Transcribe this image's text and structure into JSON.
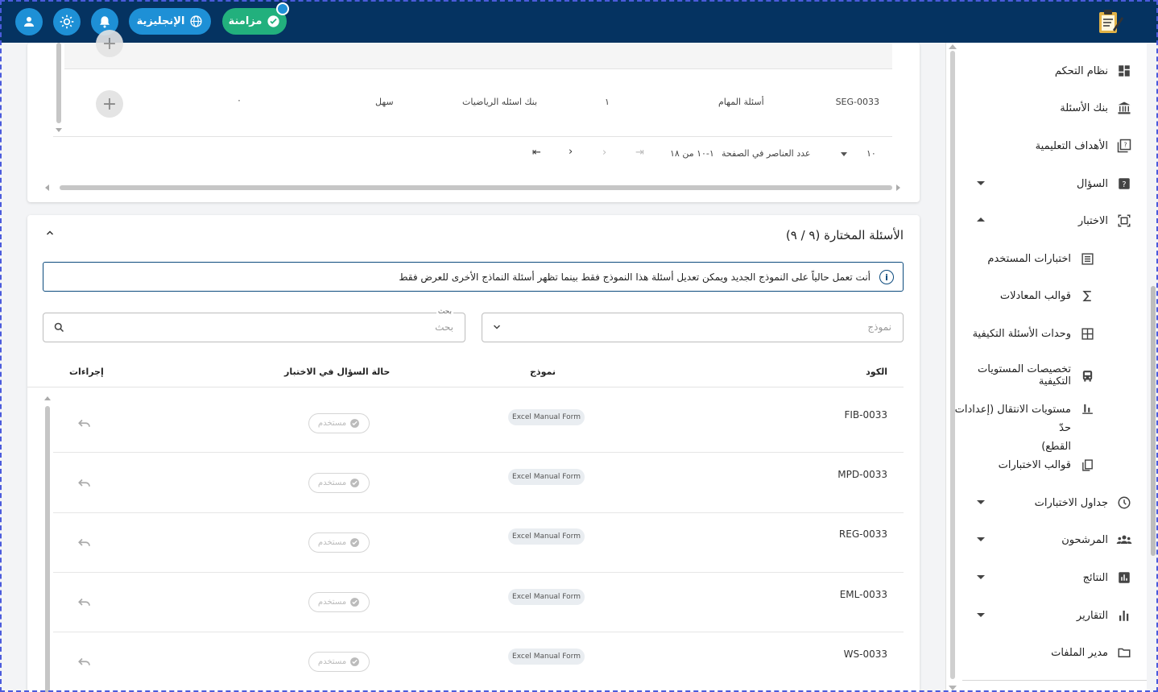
{
  "topbar": {
    "sync_label": "مزامنة",
    "language_label": "الإنجليزية",
    "icons": [
      "user-icon",
      "sun-icon",
      "bell-icon",
      "globe-icon",
      "check-icon"
    ]
  },
  "sidebar": {
    "items": [
      {
        "label": "نظام التحكم",
        "icon": "dashboard-icon"
      },
      {
        "label": "بنك الأسئلة",
        "icon": "bank-icon"
      },
      {
        "label": "الأهداف التعليمية",
        "icon": "objectives-icon"
      },
      {
        "label": "السؤال",
        "icon": "question-icon"
      },
      {
        "label": "الاختبار",
        "icon": "exam-icon"
      },
      {
        "label": "اختبارات المستخدم",
        "icon": "list-icon"
      },
      {
        "label": "قوالب المعادلات",
        "icon": "sigma-icon"
      },
      {
        "label": "وحدات الأسئلة التكيفية",
        "icon": "grid-icon"
      },
      {
        "label": "تخصيصات المستويات التكيفية",
        "icon": "bus-icon"
      },
      {
        "label": "مستويات الانتقال (إعدادات حدّ",
        "label2": "القطع)",
        "icon": "bar-icon"
      },
      {
        "label": "قوالب الاختبارات",
        "icon": "copy-icon"
      },
      {
        "label": "جداول الاختبارات",
        "icon": "clock-icon"
      },
      {
        "label": "المرشحون",
        "icon": "people-icon"
      },
      {
        "label": "النتائج",
        "icon": "results-icon"
      },
      {
        "label": "التقارير",
        "icon": "reports-icon"
      },
      {
        "label": "مدير الملفات",
        "icon": "folder-icon"
      }
    ]
  },
  "top_table": {
    "row": {
      "code": "SEG-0033",
      "type": "أسئلة المهام",
      "count": "١",
      "bank": "بنك اسئله الرياضيات",
      "difficulty": "سهل",
      "extra": "٠"
    },
    "pagination": {
      "per_page_value": "١٠",
      "per_page_label": "عدد العناصر في الصفحة",
      "range": "١-١٠ من ١٨"
    }
  },
  "selected": {
    "title": "الأسئلة المختارة (٩ / ٩)",
    "info": "أنت تعمل حالياً على النموذج الجديد ويمكن تعديل أسئلة هذا النموذج فقط بينما تظهر أسئلة النماذج الأخرى للعرض فقط",
    "model_placeholder": "نموذج",
    "search_legend": "بحث",
    "search_placeholder": "بحث",
    "columns": {
      "code": "الكود",
      "model": "نموذج",
      "status": "حالة السؤال في الاختبار",
      "actions": "إجراءات"
    },
    "rows": [
      {
        "code": "FIB-0033",
        "model": "Excel Manual Form",
        "status": "مستخدم"
      },
      {
        "code": "MPD-0033",
        "model": "Excel Manual Form",
        "status": "مستخدم"
      },
      {
        "code": "REG-0033",
        "model": "Excel Manual Form",
        "status": "مستخدم"
      },
      {
        "code": "EML-0033",
        "model": "Excel Manual Form",
        "status": "مستخدم"
      },
      {
        "code": "WS-0033",
        "model": "Excel Manual Form",
        "status": "مستخدم"
      }
    ]
  },
  "colors": {
    "topbar": "#053361",
    "accent": "#1e90d6",
    "success": "#22b07d"
  }
}
